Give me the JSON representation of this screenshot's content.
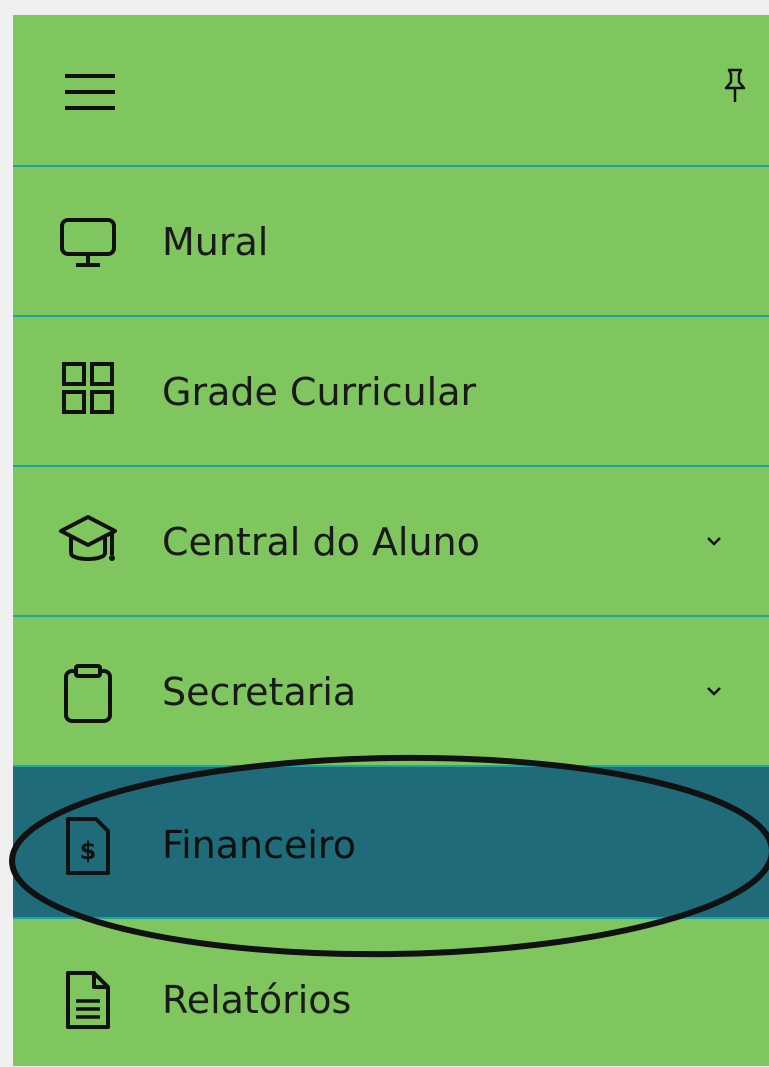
{
  "colors": {
    "sidebar_bg": "#80c65e",
    "separator": "#1aa6a6",
    "active_bg": "#1f6b7a",
    "text": "#1a1a1a"
  },
  "header": {
    "menu_icon": "hamburger-menu-icon",
    "pin_icon": "pin-icon"
  },
  "menu": {
    "items": [
      {
        "label": "Mural",
        "icon": "monitor-icon",
        "has_submenu": false,
        "active": false
      },
      {
        "label": "Grade Curricular",
        "icon": "grid-icon",
        "has_submenu": false,
        "active": false
      },
      {
        "label": "Central do Aluno",
        "icon": "graduation-cap-icon",
        "has_submenu": true,
        "active": false
      },
      {
        "label": "Secretaria",
        "icon": "clipboard-icon",
        "has_submenu": true,
        "active": false
      },
      {
        "label": "Financeiro",
        "icon": "invoice-dollar-icon",
        "has_submenu": false,
        "active": true
      },
      {
        "label": "Relatórios",
        "icon": "document-icon",
        "has_submenu": false,
        "active": false
      }
    ]
  },
  "annotation": {
    "shape": "ellipse",
    "highlights": "Financeiro"
  }
}
